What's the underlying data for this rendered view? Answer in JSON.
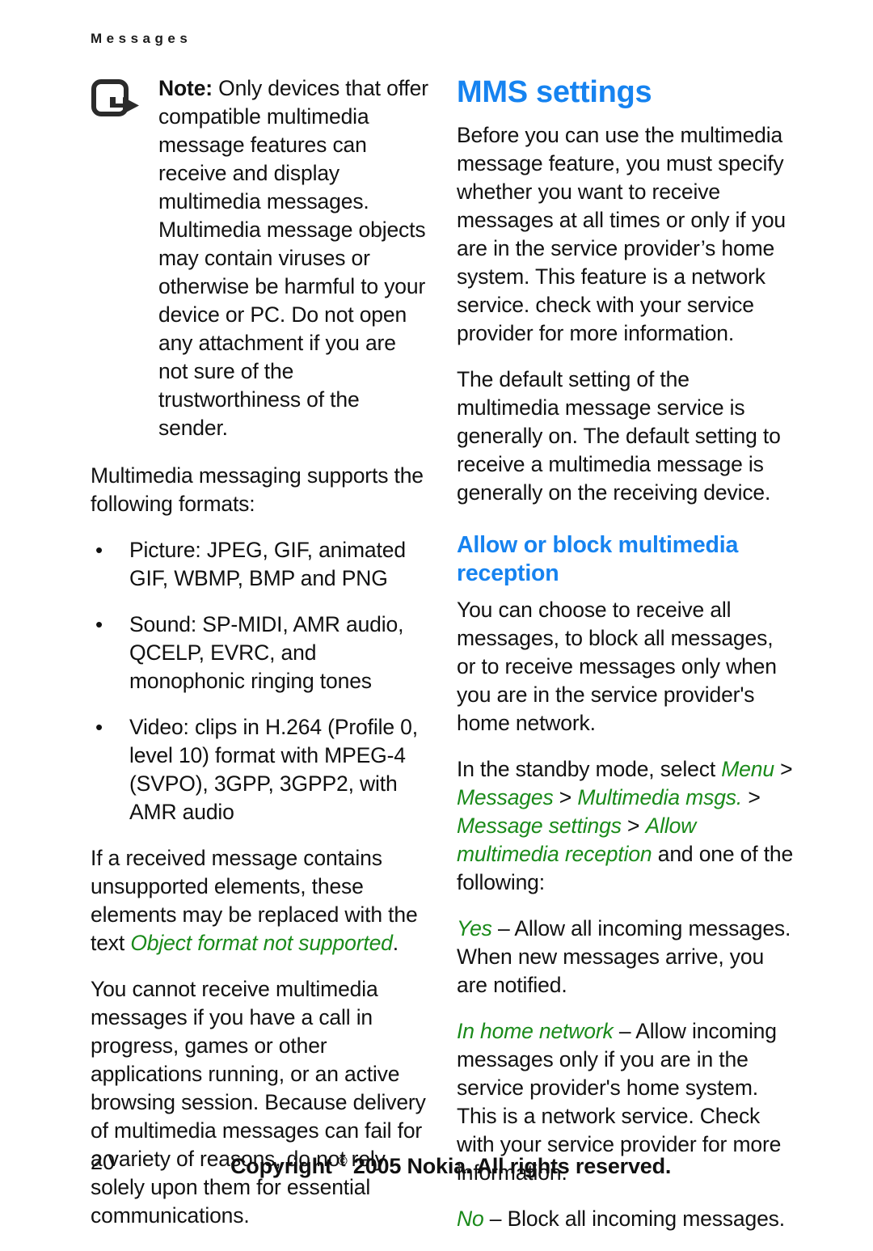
{
  "running_head": "Messages",
  "left_column": {
    "note": {
      "icon": "note-arrow-icon",
      "label": "Note:",
      "body": " Only devices that offer compatible multimedia message features can receive and display multimedia messages. Multimedia message objects may contain viruses or otherwise be harmful to your device or PC. Do not open any attachment if you are not sure of the trustworthiness of the sender."
    },
    "formats_intro": "Multimedia messaging supports the following formats:",
    "formats": [
      "Picture: JPEG, GIF, animated GIF, WBMP, BMP and PNG",
      "Sound: SP-MIDI, AMR audio, QCELP, EVRC, and monophonic ringing tones",
      "Video: clips in H.264 (Profile 0, level 10) format with MPEG-4 (SVPO), 3GPP, 3GPP2, with AMR audio"
    ],
    "unsupported_para": {
      "before": "If a received message contains unsupported elements, these elements may be replaced with the text ",
      "term": "Object format not supported",
      "after": "."
    },
    "cannot_receive_para": "You cannot receive multimedia messages if you have a call in progress, games or other applications running, or an active browsing session. Because delivery of multimedia messages can fail for a variety of reasons, do not rely solely upon them for essential communications."
  },
  "right_column": {
    "section_title": "MMS settings",
    "intro_para": "Before you can use the multimedia message feature, you must specify whether you want to receive messages at all times or only if you are in the service provider’s home system. This feature is a network service. check with your service provider for more information.",
    "default_setting_para": "The default setting of the multimedia message service is generally on. The default setting to receive a multimedia message is generally on the receiving device.",
    "sub_title": "Allow or block multimedia reception",
    "choose_para": "You can choose to receive all messages, to block all messages, or to receive messages only when you are in the service provider's home network.",
    "path_para": {
      "before": "In the standby mode, select ",
      "items": [
        "Menu",
        "Messages",
        "Multimedia msgs.",
        "Message settings",
        "Allow multimedia reception"
      ],
      "separator": " > ",
      "after": " and one of the following:"
    },
    "options": [
      {
        "term": "Yes",
        "dash": " – ",
        "text": "Allow all incoming messages. When new messages arrive, you are notified."
      },
      {
        "term": "In home network",
        "dash": " – ",
        "text": "Allow incoming messages only if you are in the service provider's home system. This is a network service. Check with your service provider for more information."
      },
      {
        "term": "No",
        "dash": " – ",
        "text": "Block all incoming messages."
      }
    ]
  },
  "footer": {
    "page_number": "20",
    "copyright_before": "Copyright ",
    "copyright_symbol": "©",
    "copyright_after": " 2005 Nokia. All rights reserved."
  },
  "colors": {
    "heading_blue": "#1683f0",
    "ui_term_green": "#1a8a1a",
    "body_text": "#121212"
  }
}
